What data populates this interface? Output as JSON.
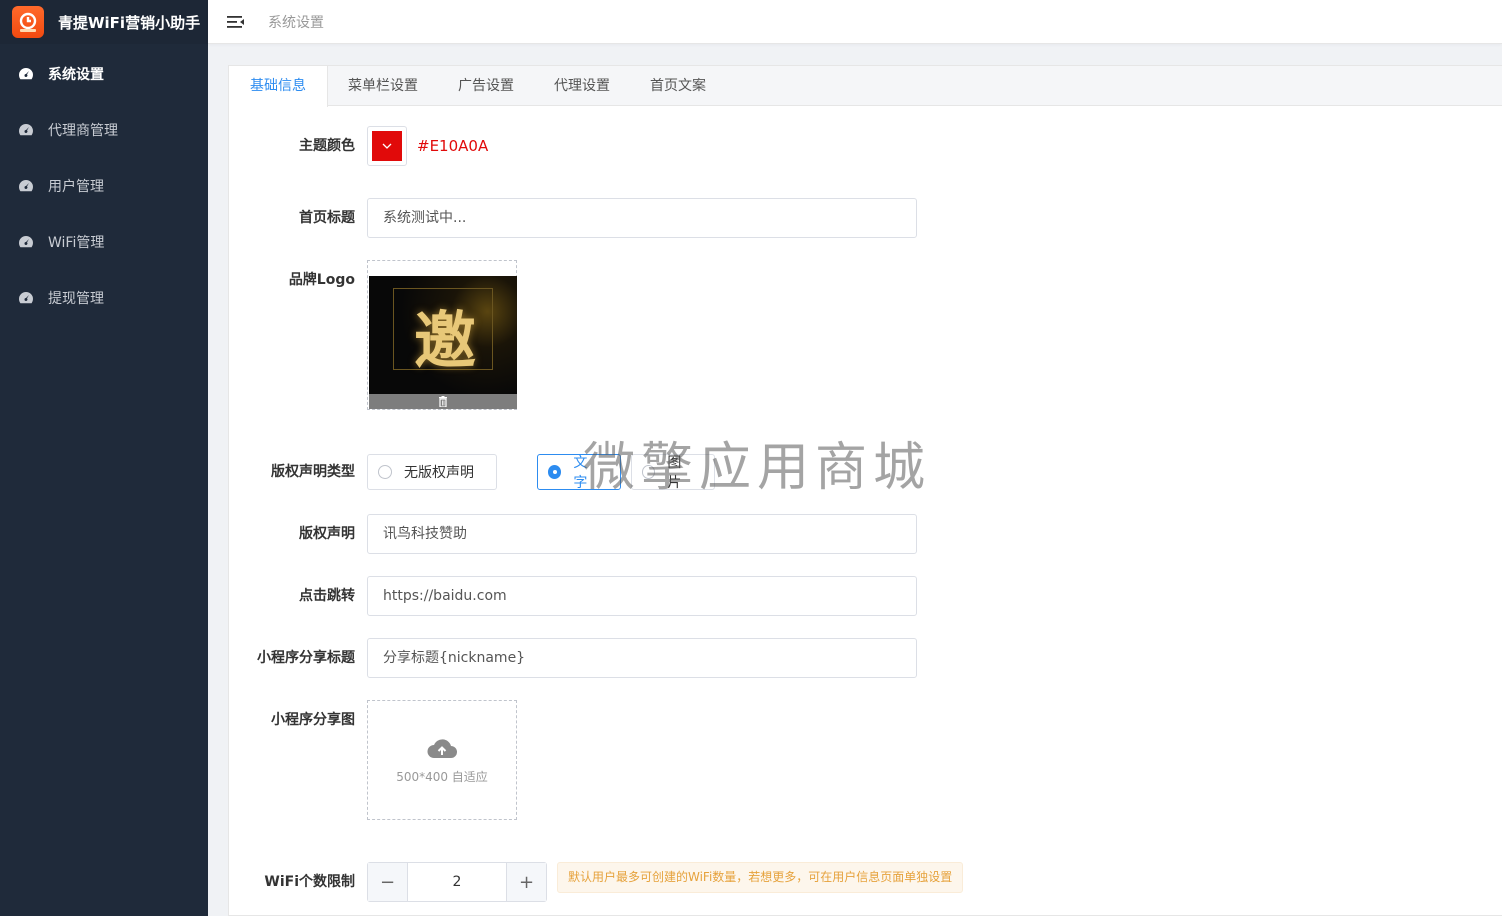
{
  "app": {
    "title": "青提WiFi营销小助手"
  },
  "sidebar": {
    "items": [
      {
        "label": "系统设置",
        "icon": "dashboard-icon",
        "active": true
      },
      {
        "label": "代理商管理",
        "icon": "dashboard-icon",
        "active": false
      },
      {
        "label": "用户管理",
        "icon": "dashboard-icon",
        "active": false
      },
      {
        "label": "WiFi管理",
        "icon": "dashboard-icon",
        "active": false
      },
      {
        "label": "提现管理",
        "icon": "dashboard-icon",
        "active": false
      }
    ]
  },
  "header": {
    "breadcrumb": "系统设置"
  },
  "tabs": [
    {
      "label": "基础信息",
      "active": true
    },
    {
      "label": "菜单栏设置",
      "active": false
    },
    {
      "label": "广告设置",
      "active": false
    },
    {
      "label": "代理设置",
      "active": false
    },
    {
      "label": "首页文案",
      "active": false
    }
  ],
  "form": {
    "theme_color": {
      "label": "主题颜色",
      "value": "#E10A0A"
    },
    "home_title": {
      "label": "首页标题",
      "value": "系统测试中..."
    },
    "brand_logo": {
      "label": "品牌Logo",
      "image_char": "邀"
    },
    "copyright_type": {
      "label": "版权声明类型",
      "options": [
        {
          "label": "无版权声明",
          "checked": false
        },
        {
          "label": "文字",
          "checked": true
        },
        {
          "label": "图片",
          "checked": false
        }
      ]
    },
    "copyright": {
      "label": "版权声明",
      "value": "讯鸟科技赞助"
    },
    "click_jump": {
      "label": "点击跳转",
      "value": "https://baidu.com"
    },
    "share_title": {
      "label": "小程序分享标题",
      "value": "分享标题{nickname}"
    },
    "share_image": {
      "label": "小程序分享图",
      "hint": "500*400 自适应"
    },
    "wifi_limit": {
      "label": "WiFi个数限制",
      "value": "2",
      "minus": "−",
      "plus": "+",
      "hint": "默认用户最多可创建的WiFi数量，若想更多，可在用户信息页面单独设置"
    }
  },
  "watermark": "微擎应用商城",
  "colors": {
    "sidebar_bg": "#1f2a3a",
    "accent": "#2d8cf0",
    "theme": "#E10A0A"
  }
}
